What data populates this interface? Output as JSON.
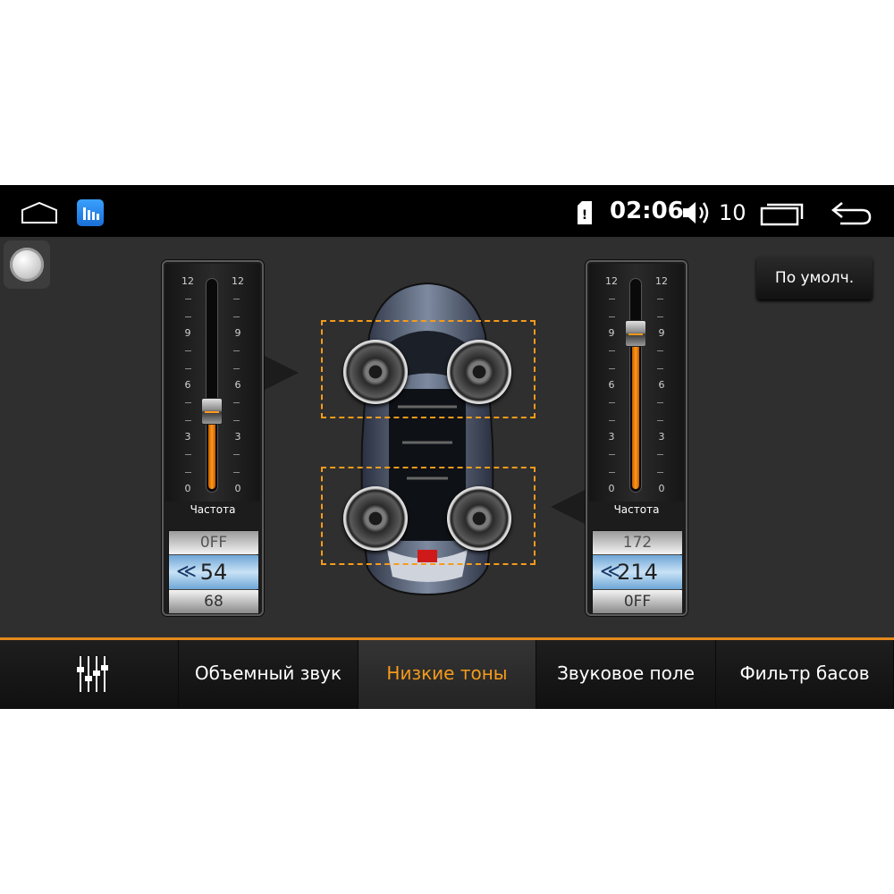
{
  "statusbar": {
    "time": "02:06",
    "volume": "10",
    "icons": [
      "home-icon",
      "app-icon",
      "sim-icon",
      "volume-icon",
      "recents-icon",
      "back-icon"
    ]
  },
  "default_button": "По умолч.",
  "left_panel": {
    "scale": [
      "12",
      "9",
      "6",
      "3",
      "0"
    ],
    "slider_value": 4.5,
    "slider_max": 12,
    "label": "Частота",
    "picker": {
      "prev": "0FF",
      "current": "54",
      "next": "68",
      "arrow": "≪"
    }
  },
  "right_panel": {
    "scale": [
      "12",
      "9",
      "6",
      "3",
      "0"
    ],
    "slider_value": 9,
    "slider_max": 12,
    "label": "Частота",
    "picker": {
      "prev": "172",
      "current": "214",
      "next": "0FF",
      "arrow": "≪"
    }
  },
  "tabs": [
    {
      "label": "",
      "icon": "equalizer-icon",
      "active": false
    },
    {
      "label": "Объемный звук",
      "active": false
    },
    {
      "label": "Низкие тоны",
      "active": true
    },
    {
      "label": "Звуковое поле",
      "active": false
    },
    {
      "label": "Фильтр басов",
      "active": false
    }
  ],
  "colors": {
    "accent": "#f59b1b",
    "background": "#2f2f2f"
  }
}
